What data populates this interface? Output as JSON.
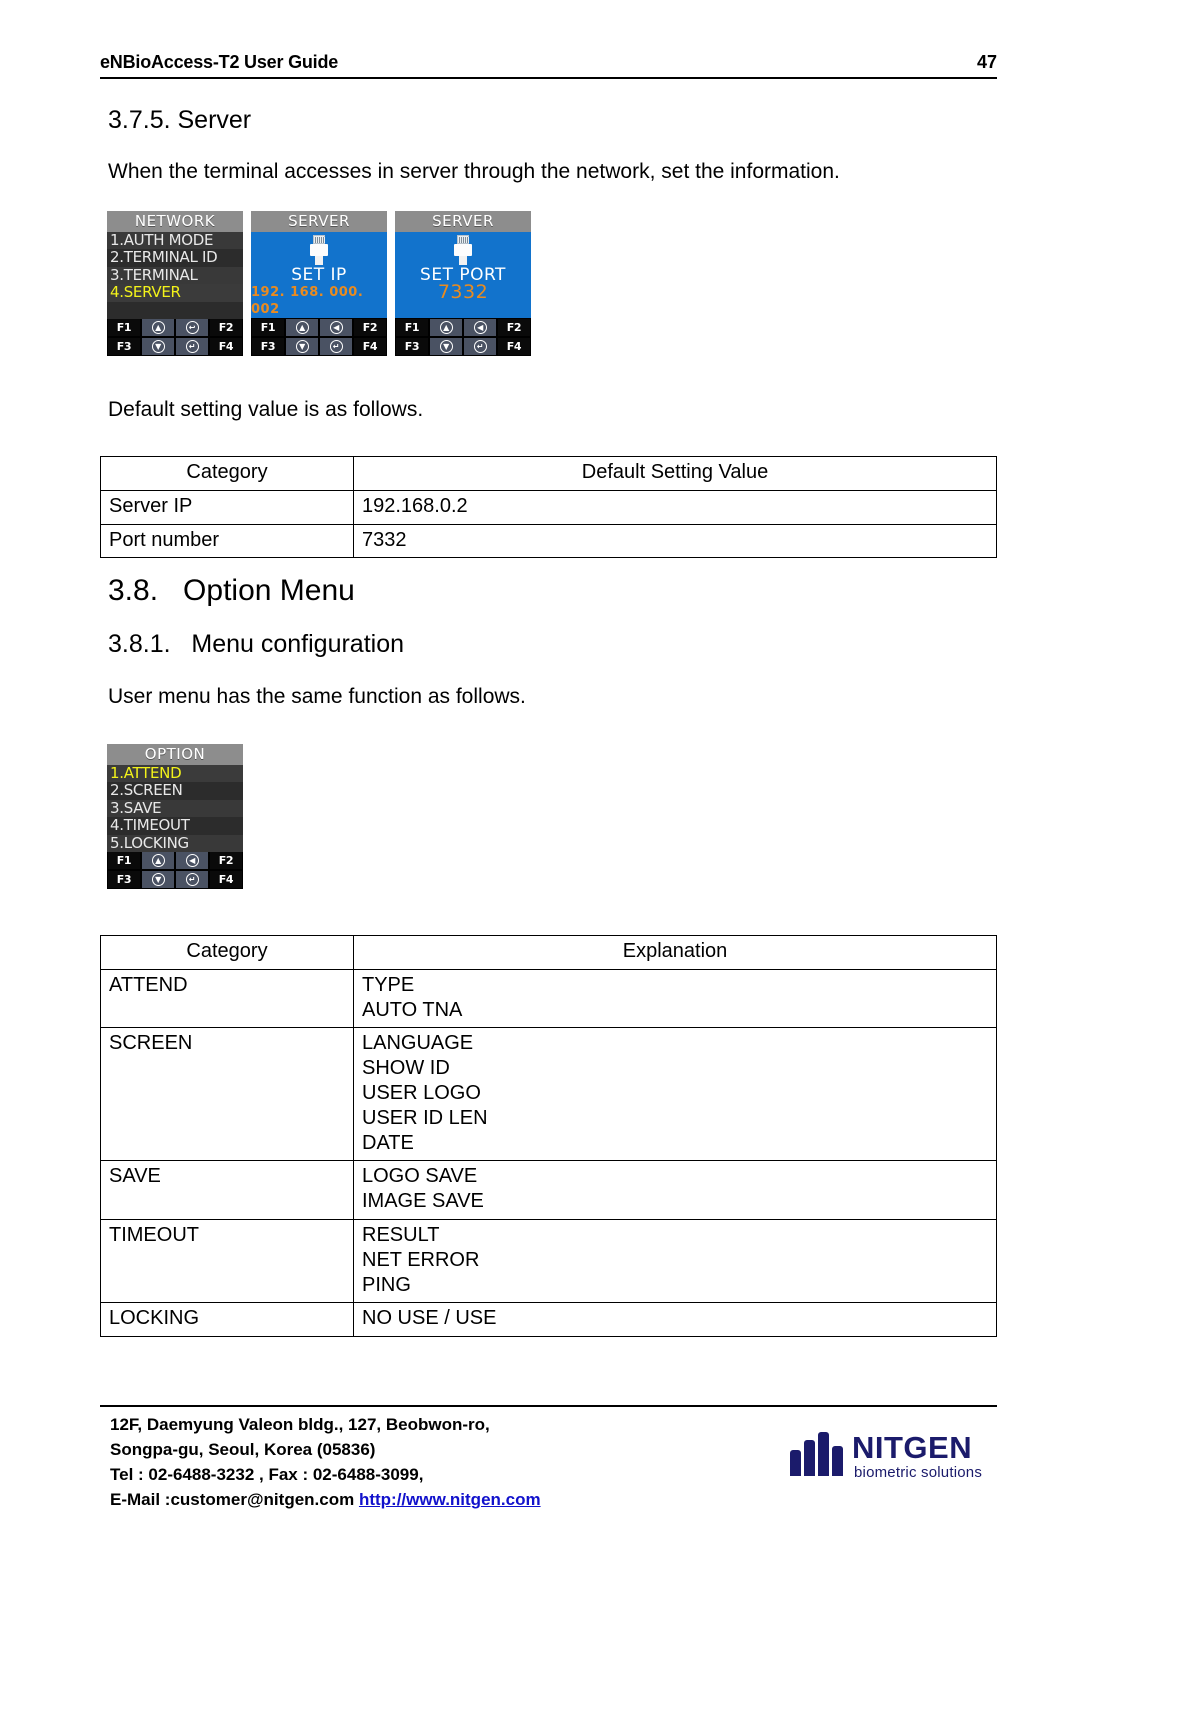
{
  "header": {
    "title": "eNBioAccess-T2 User Guide",
    "page_number": "47"
  },
  "sections": {
    "s375_heading": "3.7.5. Server",
    "s375_para": "When the terminal accesses in server through the network, set the information.",
    "default_intro": "Default setting value is as follows.",
    "s38_heading": "3.8.   Option Menu",
    "s381_heading": "3.8.1.   Menu configuration",
    "s381_para": "User menu has the same function as follows."
  },
  "device_screens": [
    {
      "title": "NETWORK",
      "type": "menu",
      "items": [
        {
          "label": "1.AUTH MODE",
          "selected": false
        },
        {
          "label": "2.TERMINAL ID",
          "selected": false
        },
        {
          "label": "3.TERMINAL",
          "selected": false
        },
        {
          "label": "4.SERVER",
          "selected": true
        },
        {
          "label": "",
          "selected": false
        }
      ],
      "keys_top": [
        "F1",
        "up-arrow-icon",
        "back-arrow-icon",
        "F2"
      ],
      "keys_bottom": [
        "F3",
        "down-arrow-icon",
        "enter-arrow-icon",
        "F4"
      ]
    },
    {
      "title": "SERVER",
      "type": "value",
      "icon": "rj45-plug-icon",
      "label": "SET IP",
      "value": "192. 168. 000. 002",
      "value_style": "small",
      "keys_top": [
        "F1",
        "up-arrow-icon",
        "left-arrow-icon",
        "F2"
      ],
      "keys_bottom": [
        "F3",
        "down-arrow-icon",
        "enter-arrow-icon",
        "F4"
      ]
    },
    {
      "title": "SERVER",
      "type": "value",
      "icon": "rj45-plug-icon",
      "label": "SET PORT",
      "value": "7332",
      "value_style": "big",
      "keys_top": [
        "F1",
        "up-arrow-icon",
        "left-arrow-icon",
        "F2"
      ],
      "keys_bottom": [
        "F3",
        "down-arrow-icon",
        "enter-arrow-icon",
        "F4"
      ]
    }
  ],
  "option_screen": {
    "title": "OPTION",
    "items": [
      {
        "label": "1.ATTEND",
        "selected": true
      },
      {
        "label": "2.SCREEN",
        "selected": false
      },
      {
        "label": "3.SAVE",
        "selected": false
      },
      {
        "label": "4.TIMEOUT",
        "selected": false
      },
      {
        "label": "5.LOCKING",
        "selected": false
      }
    ],
    "keys_top": [
      "F1",
      "up-arrow-icon",
      "left-arrow-icon",
      "F2"
    ],
    "keys_bottom": [
      "F3",
      "down-arrow-icon",
      "enter-arrow-icon",
      "F4"
    ]
  },
  "table_default": {
    "headers": [
      "Category",
      "Default Setting Value"
    ],
    "rows": [
      {
        "category": "Server IP",
        "value": "192.168.0.2"
      },
      {
        "category": "Port number",
        "value": "7332"
      }
    ]
  },
  "table_option": {
    "headers": [
      "Category",
      "Explanation"
    ],
    "rows": [
      {
        "category": "ATTEND",
        "lines": [
          "TYPE",
          "AUTO TNA"
        ]
      },
      {
        "category": "SCREEN",
        "lines": [
          "LANGUAGE",
          "SHOW ID",
          "USER LOGO",
          "USER ID LEN",
          "DATE"
        ]
      },
      {
        "category": "SAVE",
        "lines": [
          "LOGO SAVE",
          "IMAGE SAVE"
        ]
      },
      {
        "category": "TIMEOUT",
        "lines": [
          "RESULT",
          "NET ERROR",
          "PING"
        ]
      },
      {
        "category": "LOCKING",
        "lines": [
          "NO USE / USE"
        ]
      }
    ]
  },
  "footer": {
    "line1": "12F, Daemyung Valeon bldg., 127, Beobwon-ro,",
    "line2": "Songpa-gu, Seoul, Korea (05836)",
    "line3": "Tel : 02-6488-3232 , Fax : 02-6488-3099,",
    "line4_prefix": "E-Mail :customer@nitgen.com ",
    "line4_link": "http://www.nitgen.com",
    "logo_word": "NITGEN",
    "logo_tagline": "biometric solutions"
  },
  "colors": {
    "menu_selected": "#f2f21a",
    "device_blue": "#1273cc",
    "device_value_orange": "#e98b20",
    "link_blue": "#1111cc",
    "logo_navy": "#1b1b6b"
  }
}
